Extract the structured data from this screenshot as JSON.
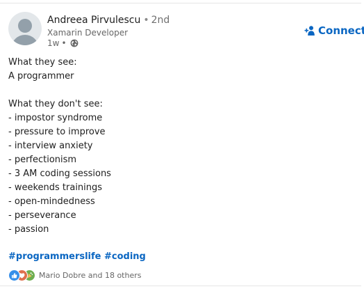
{
  "post": {
    "author": {
      "name": "Andreea Pirvulescu",
      "degree_separator": "•",
      "degree": "2nd",
      "headline": "Xamarin Developer",
      "time_ago": "1w",
      "meta_separator": "•",
      "visibility_icon": "globe-icon"
    },
    "connect": {
      "label": "Connect",
      "icon": "add-person-icon"
    },
    "lines": [
      "What they see:",
      "A programmer",
      "",
      "What they don't see:",
      "- impostor syndrome",
      "- pressure to improve",
      "- interview anxiety",
      "- perfectionism",
      "- 3 AM coding sessions",
      "- weekends trainings",
      "- open-mindedness",
      "- perseverance",
      "- passion"
    ],
    "hashtags": [
      "#programmerslife",
      "#coding"
    ],
    "reactions": {
      "icons": [
        "like-icon",
        "love-icon",
        "celebrate-icon"
      ],
      "summary": "Mario Dobre and 18 others"
    }
  },
  "colors": {
    "accent": "#0a66c2",
    "like": "#378fe9",
    "love": "#df704d",
    "celebrate": "#6dae4f"
  }
}
